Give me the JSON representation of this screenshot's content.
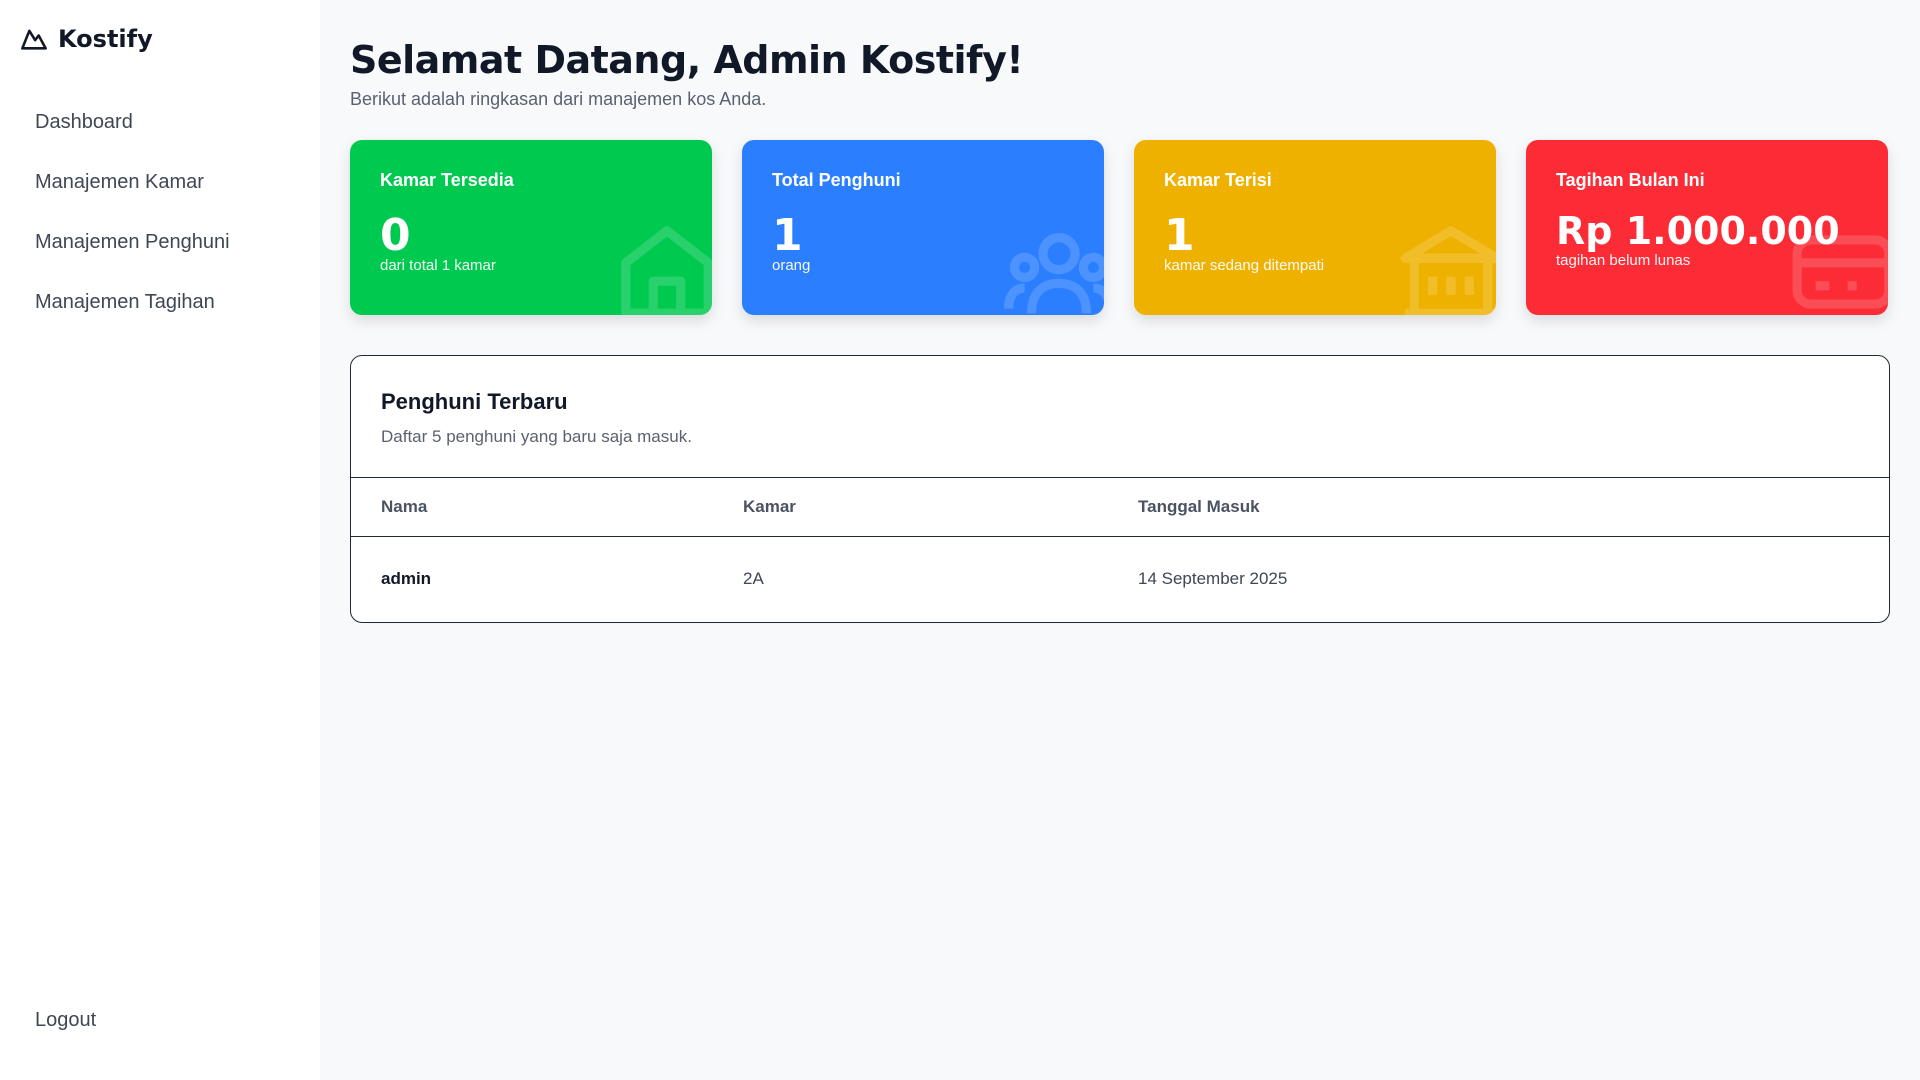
{
  "brand": {
    "name": "Kostify",
    "icon": "mountain-logo-icon"
  },
  "sidebar": {
    "items": [
      {
        "label": "Dashboard"
      },
      {
        "label": "Manajemen Kamar"
      },
      {
        "label": "Manajemen Penghuni"
      },
      {
        "label": "Manajemen Tagihan"
      }
    ],
    "logout_label": "Logout"
  },
  "header": {
    "title": "Selamat Datang, Admin Kostify!",
    "subtitle": "Berikut adalah ringkasan dari manajemen kos Anda."
  },
  "stats": [
    {
      "title": "Kamar Tersedia",
      "value": "0",
      "sub": "dari total 1 kamar",
      "color": "#00c950",
      "icon": "home-icon"
    },
    {
      "title": "Total Penghuni",
      "value": "1",
      "sub": "orang",
      "color": "#2b7fff",
      "icon": "users-icon"
    },
    {
      "title": "Kamar Terisi",
      "value": "1",
      "sub": "kamar sedang ditempati",
      "color": "#efb100",
      "icon": "building-icon"
    },
    {
      "title": "Tagihan Bulan Ini",
      "value": "Rp 1.000.000",
      "sub": "tagihan belum lunas",
      "color": "#fb2c36",
      "icon": "credit-card-icon"
    }
  ],
  "recent_residents": {
    "title": "Penghuni Terbaru",
    "description": "Daftar 5 penghuni yang baru saja masuk.",
    "columns": [
      "Nama",
      "Kamar",
      "Tanggal Masuk"
    ],
    "rows": [
      {
        "name": "admin",
        "room": "2A",
        "date": "14 September 2025"
      }
    ]
  }
}
